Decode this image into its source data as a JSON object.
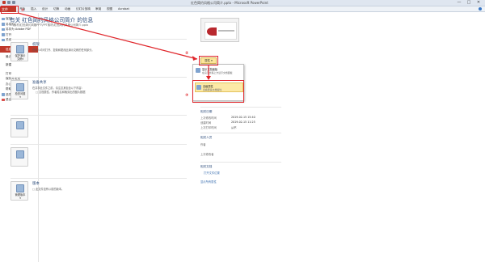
{
  "window": {
    "title": "红色简约风格公司简介.pptx - Microsoft PowerPoint",
    "min": "—",
    "max": "□",
    "close": "✕"
  },
  "ribbon": {
    "file": "文件",
    "tabs": [
      "开始",
      "插入",
      "设计",
      "切换",
      "动画",
      "幻灯片放映",
      "审阅",
      "视图",
      "Acrobat"
    ]
  },
  "nav": {
    "top_items": [
      "保存",
      "另存为",
      "另存为 Adobe PDF",
      "打开",
      "关闭"
    ],
    "active": "信息",
    "items": [
      "最近所用文件",
      "新建",
      "打印",
      "保存并发送",
      "帮助"
    ],
    "bottom_items": [
      "选项",
      "退出"
    ],
    "extra": "办公帮"
  },
  "main": {
    "title": "有关 红色简约风格公司简介 的信息",
    "path": "F:\\素材\\红色简约风格PPT\\PPT素材\\红色简约风格公司简介.pptx",
    "sections": [
      {
        "button": [
          "保护演示",
          "文稿▾"
        ],
        "title": "权限",
        "desc": [
          "任何人均可打开、复制和更改此演示文稿的任何部分。"
        ],
        "bullets": [],
        "link": ""
      },
      {
        "button": [
          "检查问题",
          "▾"
        ],
        "title": "准备共享",
        "desc": [
          "在共享此文件之前，请注意其包含以下内容："
        ],
        "bullets": [
          "□ 文档属性、作者姓名和裁剪出的图片数据"
        ],
        "link": ""
      },
      {
        "button": [
          "管理版本",
          "▾"
        ],
        "title": "版本",
        "desc": [
          "□ 此文件没有以前的版本。"
        ],
        "bullets": [],
        "link": ""
      }
    ]
  },
  "props": {
    "dropdown": "属性 ▾",
    "menu": [
      {
        "title": "显示文档面板",
        "sub": "在演示文稿上方显示文档面板"
      },
      {
        "title": "高级属性",
        "sub": "查看更多文档属性"
      }
    ],
    "rows": [
      {
        "label": "大小",
        "value": ""
      },
      {
        "label": "幻灯片",
        "value": ""
      },
      {
        "label": "隐藏幻灯片",
        "value": ""
      },
      {
        "label": "标题",
        "value": ""
      },
      {
        "label": "标记",
        "value": ""
      },
      {
        "label": "类别",
        "value": ""
      }
    ],
    "dates_head": "相关日期",
    "dates": [
      {
        "label": "上次修改时间",
        "value": "2019-02-15 15:40"
      },
      {
        "label": "创建时间",
        "value": "2019-02-15 11:25"
      },
      {
        "label": "上次打印时间",
        "value": "从不"
      }
    ],
    "people_head": "相关人员",
    "people": [
      {
        "label": "作者",
        "value": ""
      },
      {
        "label": "上次修改者",
        "value": ""
      }
    ],
    "docs_head": "相关文档",
    "docs_link": "打开文件位置",
    "showall": "显示所有属性"
  },
  "annotations": {
    "n1": "①",
    "n2": "②",
    "n3": "③"
  },
  "colors": {
    "accent": "#c0392b",
    "annotation": "#e0262b",
    "highlight": "#fde79a"
  }
}
